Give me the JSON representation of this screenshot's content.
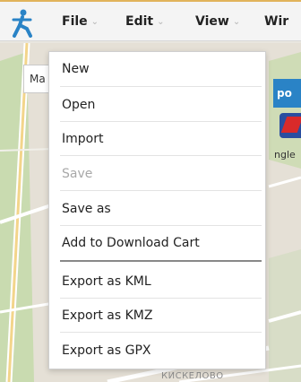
{
  "menubar": {
    "items": [
      {
        "label": "File",
        "caret": "⌄"
      },
      {
        "label": "Edit",
        "caret": "⌄"
      },
      {
        "label": "View",
        "caret": "⌄"
      },
      {
        "label": "Wir"
      }
    ]
  },
  "file_menu": {
    "items": [
      {
        "label": "New",
        "enabled": true
      },
      {
        "label": "Open",
        "enabled": true
      },
      {
        "label": "Import",
        "enabled": true
      },
      {
        "label": "Save",
        "enabled": false
      },
      {
        "label": "Save as",
        "enabled": true
      },
      {
        "label": "Add to Download Cart",
        "enabled": true
      },
      {
        "label": "Export as KML",
        "enabled": true
      },
      {
        "label": "Export as KMZ",
        "enabled": true
      },
      {
        "label": "Export as GPX",
        "enabled": true
      }
    ]
  },
  "map": {
    "chip_label": "Ma",
    "side_panel_label": "po",
    "side_text": "ngle",
    "street_label": "КИСКЕЛОВО"
  },
  "colors": {
    "accent_top_border": "#e1b35a",
    "logo_blue": "#2a83c6",
    "disabled_text": "#a8a8a8"
  },
  "icons": {
    "app_logo": "hiker-logo-icon"
  }
}
